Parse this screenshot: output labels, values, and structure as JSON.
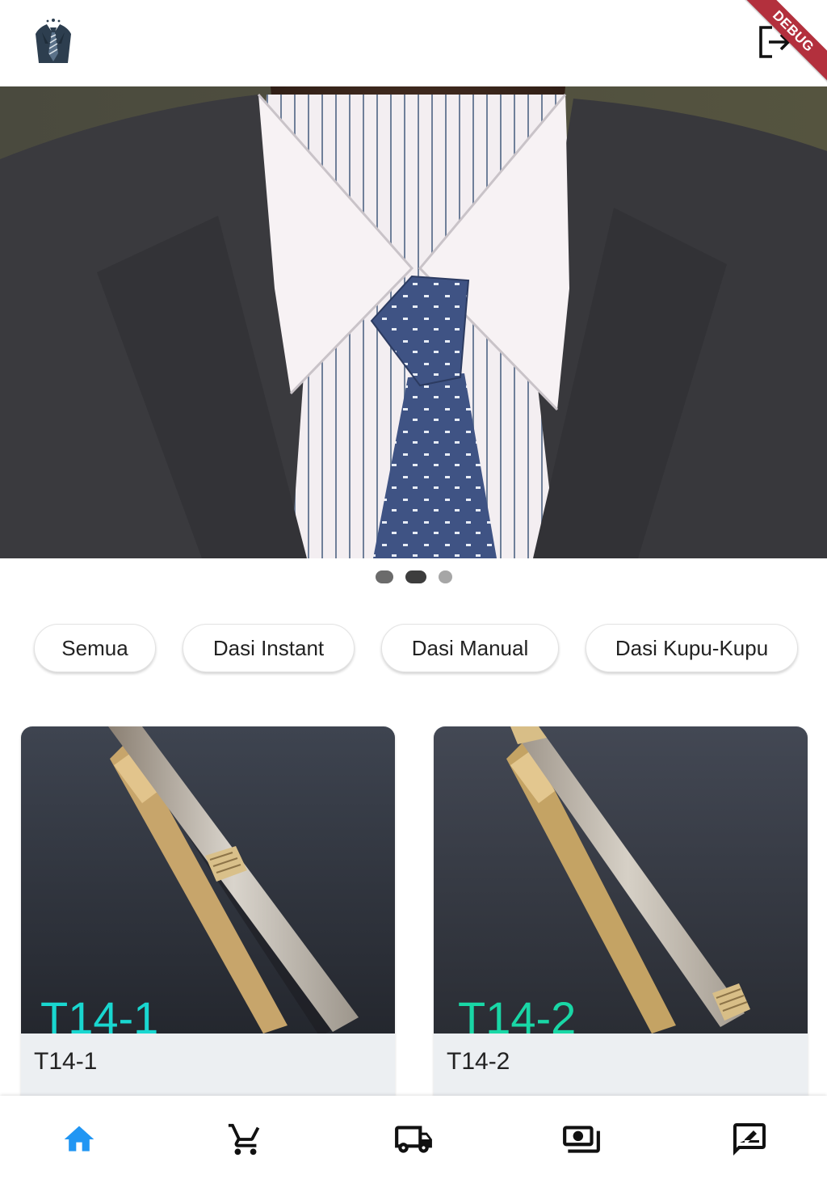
{
  "app": {
    "logo_icon": "suit-tie-logo-icon",
    "logout_icon": "logout-icon",
    "debug_label": "DEBUG"
  },
  "hero": {
    "image": "man-in-suit-with-tie-photo",
    "carousel_total": 3,
    "carousel_active": 2
  },
  "categories": [
    "Semua",
    "Dasi Instant",
    "Dasi Manual",
    "Dasi Kupu-Kupu"
  ],
  "products": [
    {
      "image_label": "T14-1",
      "title": "T14-1"
    },
    {
      "image_label": "T14-2",
      "title": "T14-2"
    }
  ],
  "bottom_nav": {
    "items": [
      {
        "icon": "home-icon",
        "active": true
      },
      {
        "icon": "cart-icon",
        "active": false
      },
      {
        "icon": "truck-icon",
        "active": false
      },
      {
        "icon": "payments-icon",
        "active": false
      },
      {
        "icon": "rate-review-icon",
        "active": false
      }
    ],
    "active_color": "#2196f3",
    "inactive_color": "#111111"
  }
}
